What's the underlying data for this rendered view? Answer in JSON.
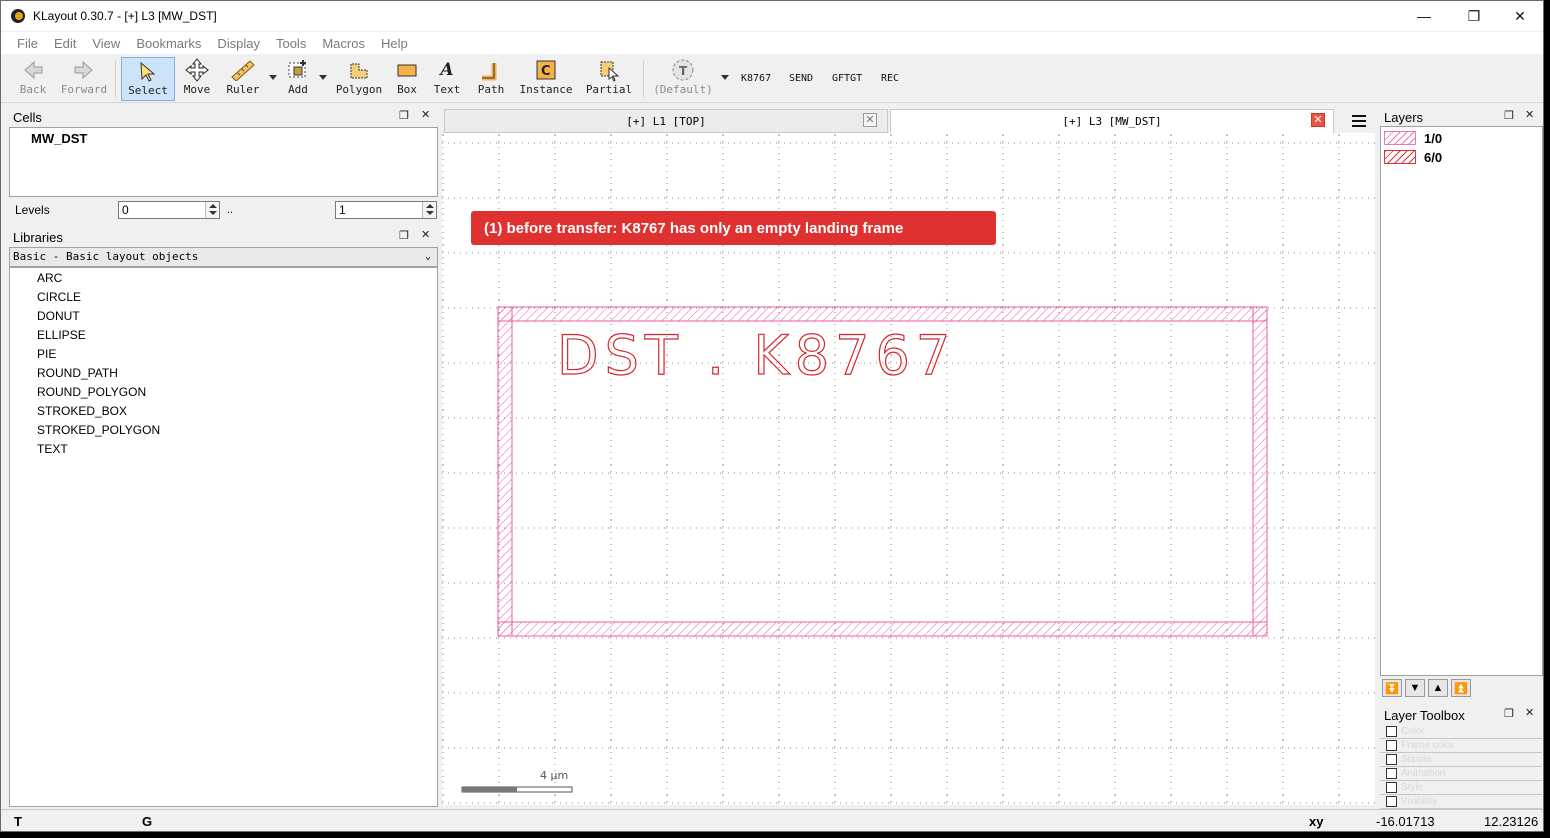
{
  "window": {
    "title": "KLayout 0.30.7 - [+] L3 [MW_DST]",
    "minimize_glyph": "—",
    "maximize_glyph": "❐",
    "close_glyph": "✕"
  },
  "menu": [
    "File",
    "Edit",
    "View",
    "Bookmarks",
    "Display",
    "Tools",
    "Macros",
    "Help"
  ],
  "toolbar": {
    "back": "Back",
    "forward": "Forward",
    "select": "Select",
    "move": "Move",
    "ruler": "Ruler",
    "add": "Add",
    "polygon": "Polygon",
    "box": "Box",
    "text": "Text",
    "path": "Path",
    "instance": "Instance",
    "partial": "Partial",
    "default": "(Default)",
    "macro_buttons": [
      "K8767",
      "SEND",
      "GFTGT",
      "REC"
    ]
  },
  "cells_panel": {
    "title": "Cells",
    "cell": "MW_DST",
    "levels_label": "Levels",
    "level_from": "0",
    "level_sep": "..",
    "level_to": "1"
  },
  "libraries_panel": {
    "title": "Libraries",
    "selected_library": "Basic - Basic layout objects",
    "items": [
      "ARC",
      "CIRCLE",
      "DONUT",
      "ELLIPSE",
      "PIE",
      "ROUND_PATH",
      "ROUND_POLYGON",
      "STROKED_BOX",
      "STROKED_POLYGON",
      "TEXT"
    ]
  },
  "tabs": [
    {
      "label": "[+] L1 [TOP]",
      "close": "✕"
    },
    {
      "label": "[+] L3 [MW_DST]",
      "close": "✕"
    }
  ],
  "canvas": {
    "annotation": "(1) before transfer: K8767 has only an empty landing frame",
    "layout_text": "DST . K8767",
    "scale_label": "4 µm",
    "colors": {
      "frame": "#ef5aa0",
      "text": "#d9262e",
      "grid": "#7a7a7a",
      "annotation_bg": "#e03131"
    }
  },
  "layers_panel": {
    "title": "Layers",
    "layers": [
      {
        "name": "1/0",
        "color": "#ef77b4"
      },
      {
        "name": "6/0",
        "color": "#e0303a"
      }
    ]
  },
  "layer_toolbox": {
    "title": "Layer Toolbox",
    "rows": [
      "Color",
      "Frame color",
      "Stipple",
      "Animation",
      "Style",
      "Visibility"
    ]
  },
  "status_bar": {
    "left1": "T",
    "left2": "G",
    "coord_label": "xy",
    "x": "-16.01713",
    "y": "12.23126"
  },
  "icons": [
    "back-icon",
    "forward-icon",
    "select-icon",
    "move-icon",
    "ruler-icon",
    "add-icon",
    "polygon-icon",
    "box-icon",
    "text-icon",
    "path-icon",
    "instance-icon",
    "partial-icon",
    "default-icon",
    "hamburger-icon"
  ]
}
